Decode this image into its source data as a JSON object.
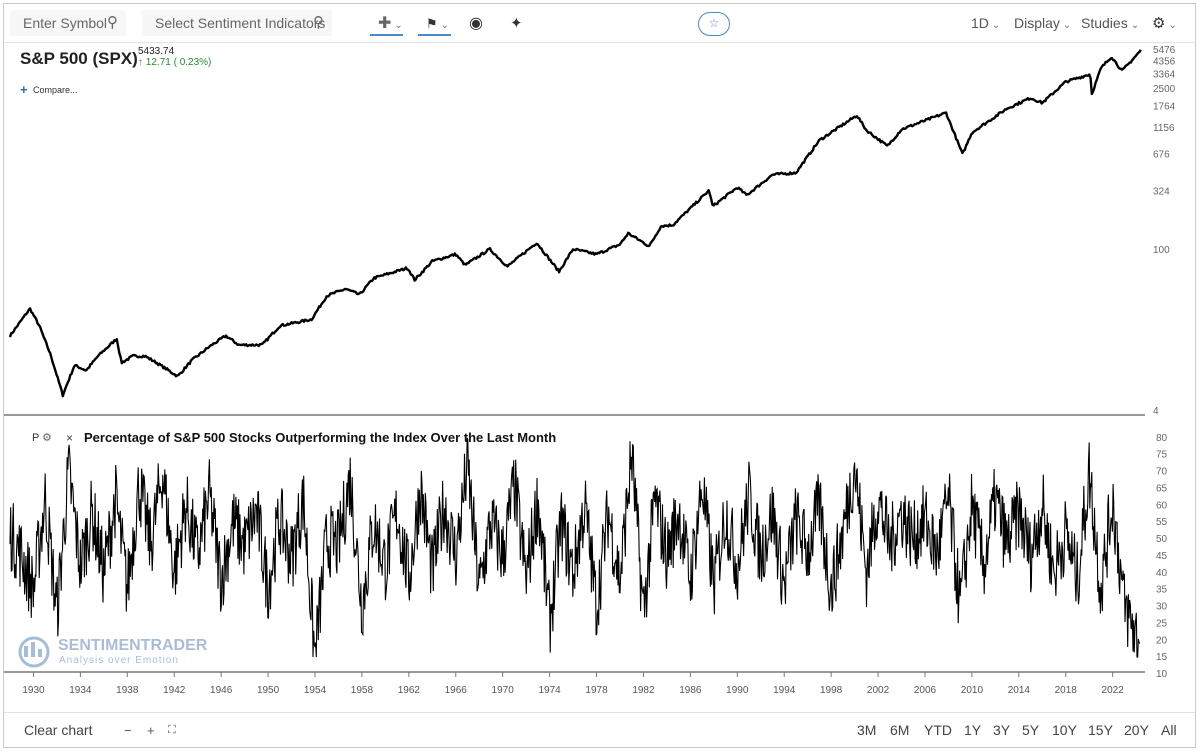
{
  "toolbar": {
    "symbol_placeholder": "Enter Symbol",
    "sentiment_placeholder": "Select Sentiment Indicators",
    "crosshair_icon": "crosshair-icon",
    "marker_icon": "flag-icon",
    "eye_icon": "eye-icon",
    "pin_icon": "pin-icon",
    "star_icon": "star-icon",
    "interval": "1D",
    "display": "Display",
    "studies": "Studies",
    "settings_icon": "gear-icon"
  },
  "main_chart": {
    "symbol_title": "S&P 500 (SPX)",
    "last_price": "5433.74",
    "change": "12.71 ( 0.23%)",
    "compare_label": "Compare..."
  },
  "indicator": {
    "letter": "P",
    "title": "Percentage of S&P 500 Stocks Outperforming the Index Over the Last Month"
  },
  "watermark": {
    "brand": "SENTIMENTRADER",
    "tagline": "Analysis over Emotion"
  },
  "bottom": {
    "clear_label": "Clear chart",
    "zoom_out": "−",
    "zoom_in": "+",
    "ranges": [
      "3M",
      "6M",
      "YTD",
      "1Y",
      "3Y",
      "5Y",
      "10Y",
      "15Y",
      "20Y",
      "All"
    ]
  },
  "colors": {
    "line": "#000000",
    "accent": "#4d87c7",
    "up": "#2a8a2a"
  },
  "chart_data": [
    {
      "type": "line",
      "scale": "log",
      "title": "S&P 500 (SPX)",
      "y_ticks": [
        4,
        100,
        324,
        676,
        1156,
        1764,
        2500,
        3364,
        4356,
        5476
      ],
      "ylim": [
        4,
        5476
      ],
      "x_ticks": [
        "1930",
        "1934",
        "1938",
        "1942",
        "1946",
        "1950",
        "1954",
        "1958",
        "1962",
        "1966",
        "1970",
        "1974",
        "1978",
        "1982",
        "1986",
        "1990",
        "1994",
        "1998",
        "2002",
        "2006",
        "2010",
        "2014",
        "2018",
        "2022"
      ],
      "xlim": [
        1928,
        2024.5
      ],
      "x": [
        1928,
        1929.7,
        1930.5,
        1931.5,
        1932.5,
        1933.5,
        1934.5,
        1935.5,
        1937.1,
        1937.5,
        1938.5,
        1939.5,
        1940.5,
        1942.3,
        1943.5,
        1945,
        1946.4,
        1947.5,
        1949.5,
        1951,
        1953.7,
        1955,
        1956.6,
        1957.8,
        1959,
        1961.9,
        1962.5,
        1964,
        1966,
        1966.8,
        1968.9,
        1970.4,
        1972.9,
        1974.8,
        1976,
        1978,
        1980,
        1980.7,
        1982.5,
        1983.5,
        1984.5,
        1987.6,
        1987.9,
        1990,
        1990.8,
        1993,
        1995,
        1997,
        2000.2,
        2001,
        2002.8,
        2004,
        2007.8,
        2009.2,
        2010,
        2013,
        2015,
        2016,
        2018,
        2020.1,
        2020.2,
        2021,
        2021.9,
        2022.8,
        2023.5,
        2024.4
      ],
      "y": [
        18,
        31,
        22,
        12,
        5.5,
        10,
        9,
        12,
        17,
        10.5,
        12,
        12,
        10.5,
        8,
        11,
        14.5,
        18,
        15,
        15,
        22,
        25,
        40,
        46,
        41,
        57,
        70,
        55,
        80,
        92,
        74,
        102,
        72,
        116,
        65,
        102,
        92,
        112,
        140,
        108,
        162,
        165,
        330,
        240,
        350,
        300,
        452,
        470,
        900,
        1480,
        1100,
        800,
        1120,
        1560,
        680,
        1050,
        1700,
        2100,
        1900,
        2900,
        3380,
        2240,
        3800,
        4800,
        3600,
        4300,
        5434
      ]
    },
    {
      "type": "line",
      "title": "Percentage of S&P 500 Stocks Outperforming the Index Over the Last Month",
      "y_ticks": [
        10,
        15,
        20,
        25,
        30,
        35,
        40,
        45,
        50,
        55,
        60,
        65,
        70,
        75,
        80
      ],
      "ylim": [
        10,
        82
      ],
      "xlim": [
        1928,
        2024.5
      ],
      "x": [
        1928,
        1929,
        1930,
        1931,
        1932,
        1933,
        1934,
        1935,
        1936,
        1937,
        1938,
        1939,
        1940,
        1941,
        1942,
        1943,
        1944,
        1945,
        1946,
        1947,
        1948,
        1949,
        1950,
        1951,
        1952,
        1953,
        1954,
        1955,
        1956,
        1957,
        1958,
        1959,
        1960,
        1961,
        1962,
        1963,
        1964,
        1965,
        1966,
        1967,
        1968,
        1969,
        1970,
        1971,
        1972,
        1973,
        1974,
        1975,
        1976,
        1977,
        1978,
        1979,
        1980,
        1981,
        1982,
        1983,
        1984,
        1985,
        1986,
        1987,
        1988,
        1989,
        1990,
        1991,
        1992,
        1993,
        1994,
        1995,
        1996,
        1997,
        1998,
        1999,
        2000,
        2001,
        2002,
        2003,
        2004,
        2005,
        2006,
        2007,
        2008,
        2009,
        2010,
        2011,
        2012,
        2013,
        2014,
        2015,
        2016,
        2017,
        2018,
        2019,
        2020,
        2021,
        2022,
        2023,
        2024.3
      ],
      "y": [
        52,
        45,
        35,
        62,
        28,
        70,
        42,
        58,
        40,
        62,
        35,
        66,
        48,
        70,
        40,
        60,
        45,
        63,
        38,
        55,
        48,
        58,
        36,
        56,
        44,
        62,
        15,
        50,
        48,
        68,
        30,
        55,
        42,
        58,
        38,
        65,
        40,
        60,
        45,
        72,
        35,
        55,
        45,
        66,
        38,
        62,
        25,
        55,
        40,
        60,
        30,
        58,
        38,
        75,
        28,
        62,
        45,
        58,
        38,
        66,
        36,
        58,
        42,
        63,
        45,
        58,
        36,
        56,
        46,
        60,
        35,
        52,
        72,
        40,
        62,
        48,
        58,
        50,
        56,
        45,
        62,
        30,
        60,
        42,
        62,
        48,
        58,
        45,
        60,
        40,
        52,
        38,
        70,
        35,
        62,
        30,
        19
      ]
    }
  ]
}
